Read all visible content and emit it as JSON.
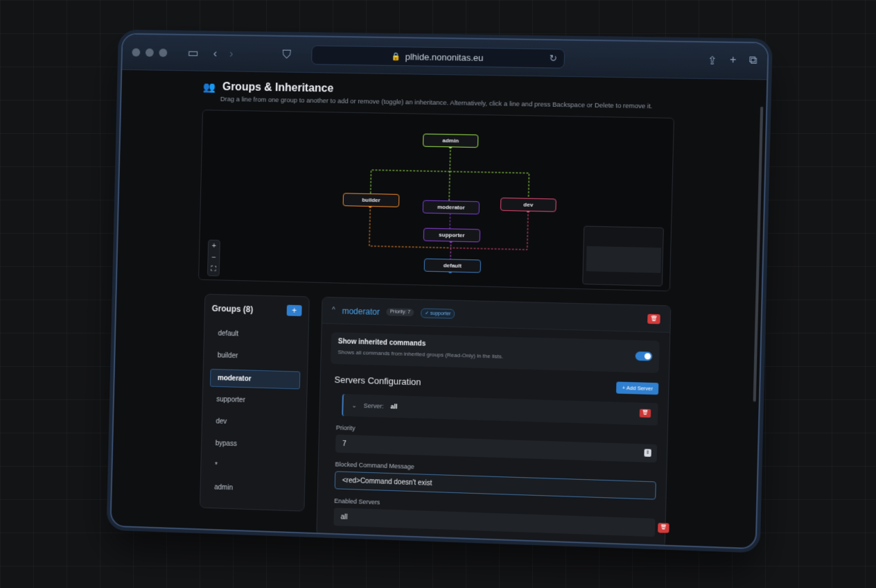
{
  "browser": {
    "url": "plhide.nononitas.eu"
  },
  "page": {
    "title": "Groups & Inheritance",
    "description": "Drag a line from one group to another to add or remove (toggle) an inheritance. Alternatively, click a line and press Backspace or Delete to remove it."
  },
  "graph": {
    "nodes": [
      {
        "label": "admin",
        "color": "#9be34a"
      },
      {
        "label": "builder",
        "color": "#f08a2a"
      },
      {
        "label": "moderator",
        "color": "#7a3fd6"
      },
      {
        "label": "dev",
        "color": "#e34a73"
      },
      {
        "label": "supporter",
        "color": "#8a3fd6"
      },
      {
        "label": "default",
        "color": "#3d7fc4"
      }
    ],
    "zoom_in": "+",
    "zoom_out": "−",
    "fit": "⛶"
  },
  "groups_panel": {
    "title": "Groups (8)",
    "add_label": "+",
    "items": [
      "default",
      "builder",
      "moderator",
      "supporter",
      "dev",
      "bypass",
      "*",
      "admin"
    ],
    "selected": "moderator"
  },
  "detail": {
    "group_name": "moderator",
    "priority_badge": "Priority: 7",
    "inherits_badge": "✓ supporter",
    "delete_icon": "🗑",
    "toggle_title": "Show inherited commands",
    "toggle_sub": "Shows all commands from inherited groups (Read-Only) in the lists.",
    "servers_title": "Servers Configuration",
    "add_server": "+ Add Server",
    "server_label": "Server:",
    "server_value": "all",
    "priority_label": "Priority",
    "priority_value": "7",
    "blocked_label": "Blocked Command Message",
    "blocked_value": "<red>Command doesn't exist",
    "enabled_label": "Enabled Servers",
    "enabled_value": "all"
  }
}
